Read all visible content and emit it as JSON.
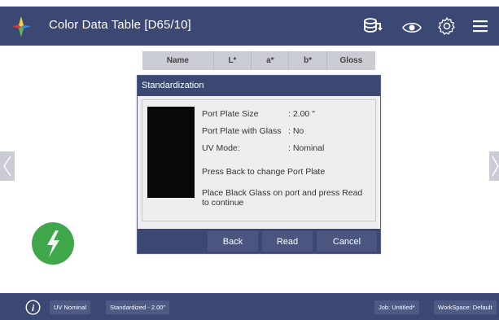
{
  "header": {
    "title": "Color Data Table [D65/10]",
    "bg_color": "#3b4873",
    "icons": [
      "app-logo-icon",
      "database-sync-icon",
      "eye-icon",
      "gear-icon",
      "menu-icon"
    ]
  },
  "table": {
    "columns": [
      "Name",
      "L*",
      "a*",
      "b*",
      "Gloss"
    ]
  },
  "dialog": {
    "title": "Standardization",
    "port_plate_size_label": "Port Plate Size",
    "port_plate_size_value": ": 2.00 \"",
    "port_plate_glass_label": "Port Plate with Glass",
    "port_plate_glass_value": ": No",
    "uv_mode_label": "UV Mode:",
    "uv_mode_value": ": Nominal",
    "message_back": "Press Back to change Port Plate",
    "message_place": "Place Black Glass on port and press Read to continue",
    "buttons": {
      "back": "Back",
      "read": "Read",
      "cancel": "Cancel"
    }
  },
  "status_bar": {
    "uv": "UV Nominal",
    "standardized": "Standardized - 2.00\"",
    "job": "Job: Untitled*",
    "workspace": "WorkSpace: Default"
  },
  "colors": {
    "accent": "#3b4873",
    "measure_button": "#3fa74a"
  }
}
